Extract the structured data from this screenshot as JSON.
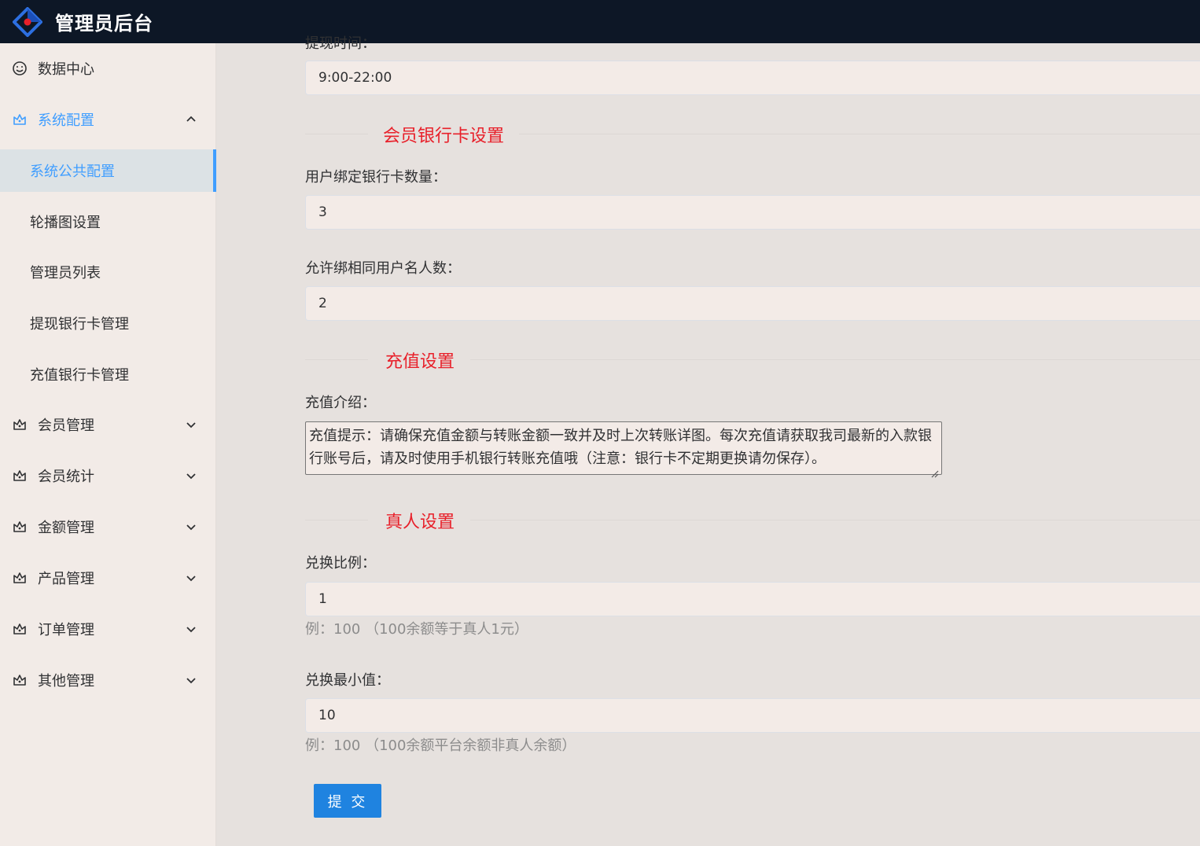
{
  "header": {
    "title": "管理员后台"
  },
  "sidebar": {
    "items": [
      {
        "label": "数据中心",
        "icon": "smile-icon"
      },
      {
        "label": "系统配置",
        "icon": "crown-icon",
        "expanded": true,
        "children": [
          {
            "label": "系统公共配置",
            "selected": true
          },
          {
            "label": "轮播图设置"
          },
          {
            "label": "管理员列表"
          },
          {
            "label": "提现银行卡管理"
          },
          {
            "label": "充值银行卡管理"
          }
        ]
      },
      {
        "label": "会员管理",
        "icon": "crown-icon"
      },
      {
        "label": "会员统计",
        "icon": "crown-icon"
      },
      {
        "label": "金额管理",
        "icon": "crown-icon"
      },
      {
        "label": "产品管理",
        "icon": "crown-icon"
      },
      {
        "label": "订单管理",
        "icon": "crown-icon"
      },
      {
        "label": "其他管理",
        "icon": "crown-icon"
      }
    ]
  },
  "form": {
    "withdraw_time": {
      "label": "提现时间：",
      "value": "9:00-22:00"
    },
    "bank_section_title": "会员银行卡设置",
    "bind_card_count": {
      "label": "用户绑定银行卡数量：",
      "value": "3"
    },
    "same_name_count": {
      "label": "允许绑相同用户名人数：",
      "value": "2"
    },
    "recharge_section_title": "充值设置",
    "recharge_intro": {
      "label": "充值介绍：",
      "value": "充值提示：请确保充值金额与转账金额一致并及时上次转账详图。每次充值请获取我司最新的入款银行账号后，请及时使用手机银行转账充值哦（注意：银行卡不定期更换请勿保存）。"
    },
    "real_section_title": "真人设置",
    "exchange_ratio": {
      "label": "兑换比例：",
      "value": "1",
      "hint": "例：100 （100余额等于真人1元）"
    },
    "exchange_min": {
      "label": "兑换最小值：",
      "value": "10",
      "hint": "例：100 （100余额平台余额非真人余额）"
    },
    "submit_label": "提 交"
  },
  "colors": {
    "accent": "#409eff",
    "section_title": "#e8202a",
    "topbar": "#0d1726",
    "submit": "#1f83e0"
  }
}
